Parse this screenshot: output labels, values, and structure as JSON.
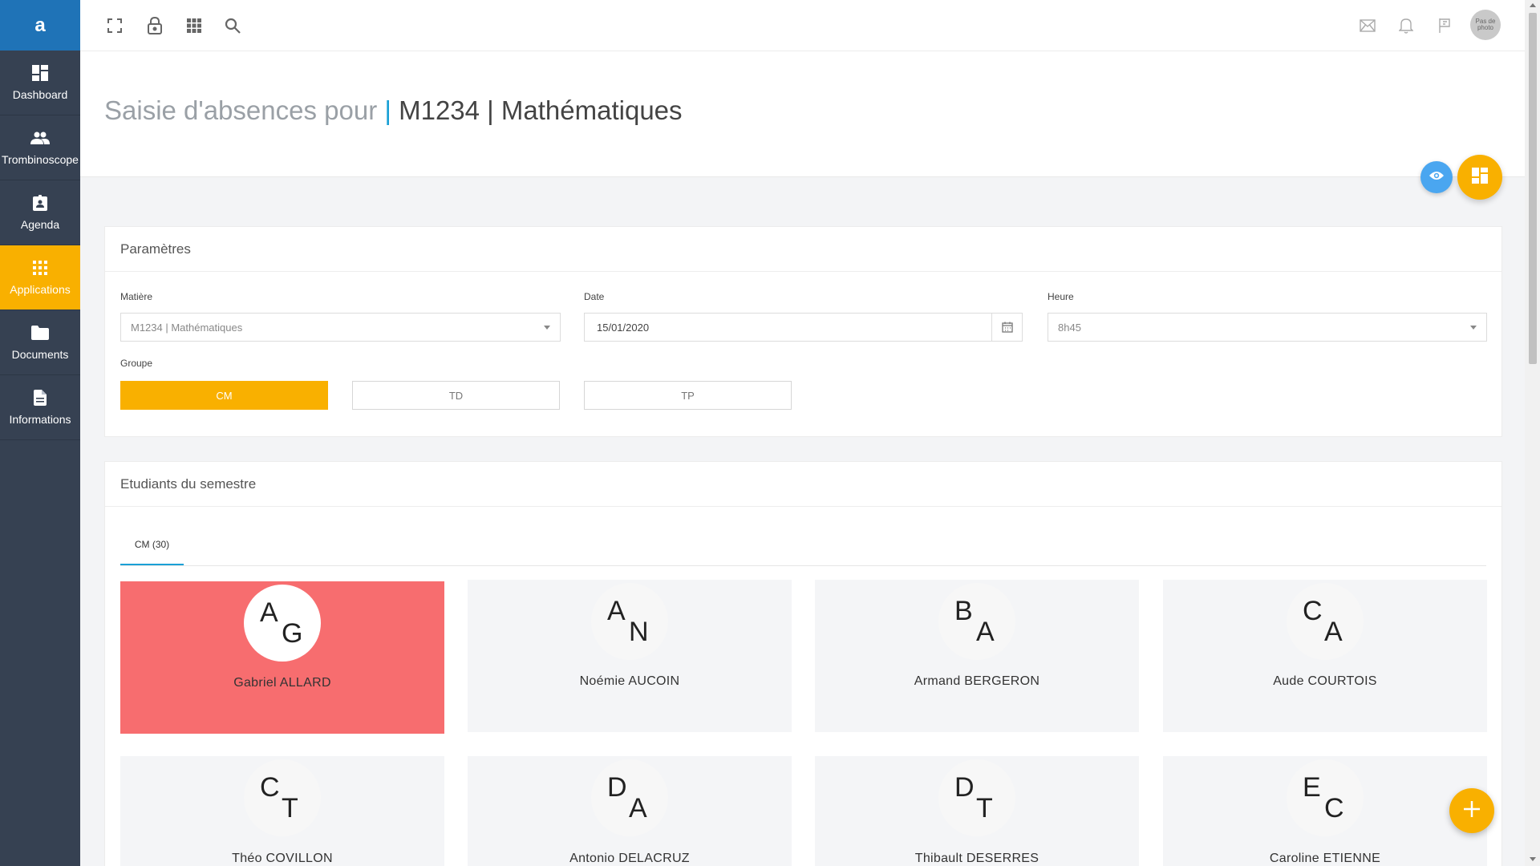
{
  "app": {
    "logo": "a"
  },
  "sidebar": {
    "items": [
      {
        "label": "Dashboard",
        "icon": "dashboard-icon"
      },
      {
        "label": "Trombinoscope",
        "icon": "people-icon"
      },
      {
        "label": "Agenda",
        "icon": "agenda-icon"
      },
      {
        "label": "Applications",
        "icon": "apps-grid-icon",
        "active": true
      },
      {
        "label": "Documents",
        "icon": "folder-icon"
      },
      {
        "label": "Informations",
        "icon": "file-icon"
      }
    ]
  },
  "topbar": {
    "left_icons": [
      "fullscreen-icon",
      "lock-icon",
      "apps-grid-icon",
      "search-icon"
    ],
    "right_icons": [
      "mail-icon",
      "bell-icon",
      "flag-icon"
    ],
    "avatar_text": "Pas de photo"
  },
  "header": {
    "title_prefix": "Saisie d'absences pour",
    "title_separator": "|",
    "title_main": "M1234 | Mathématiques"
  },
  "parametres": {
    "title": "Paramètres",
    "matiere_label": "Matière",
    "matiere_value": "M1234 | Mathématiques",
    "date_label": "Date",
    "date_value": "15/01/2020",
    "heure_label": "Heure",
    "heure_value": "8h45",
    "groupe_label": "Groupe",
    "groupes": [
      {
        "label": "CM",
        "active": true
      },
      {
        "label": "TD",
        "active": false
      },
      {
        "label": "TP",
        "active": false
      }
    ]
  },
  "students": {
    "title": "Etudiants du semestre",
    "tab": "CM (30)",
    "list": [
      {
        "first": "A",
        "last": "G",
        "name": "Gabriel ALLARD",
        "absent": true
      },
      {
        "first": "A",
        "last": "N",
        "name": "Noémie AUCOIN",
        "absent": false
      },
      {
        "first": "B",
        "last": "A",
        "name": "Armand BERGERON",
        "absent": false
      },
      {
        "first": "C",
        "last": "A",
        "name": "Aude COURTOIS",
        "absent": false
      },
      {
        "first": "C",
        "last": "T",
        "name": "Théo COVILLON",
        "absent": false
      },
      {
        "first": "D",
        "last": "A",
        "name": "Antonio DELACRUZ",
        "absent": false
      },
      {
        "first": "D",
        "last": "T",
        "name": "Thibault DESERRES",
        "absent": false
      },
      {
        "first": "E",
        "last": "C",
        "name": "Caroline ETIENNE",
        "absent": false
      }
    ]
  },
  "colors": {
    "accent": "#f9b000",
    "sidebar": "#364152",
    "logo_bg": "#1f73b7",
    "absent": "#f76d6f",
    "link": "#1aa0d6"
  }
}
